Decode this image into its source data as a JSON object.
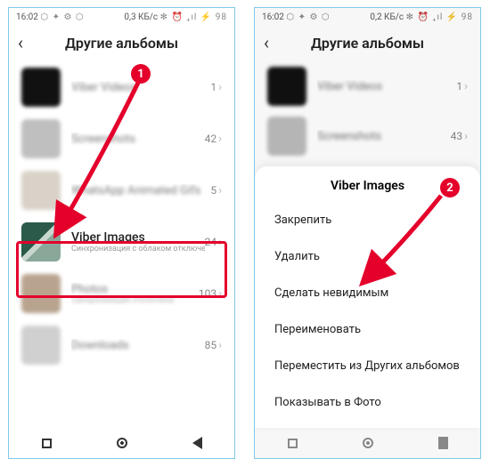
{
  "status": {
    "time": "16:02",
    "icons_left": "⬡ ✦ ⚙ ⬡",
    "net_left": "0,3 КБ/с",
    "net_right": "0,2 КБ/с",
    "icons_right": "✻ ⏰ ₊ıl ⚡ 98"
  },
  "header": {
    "title": "Другие альбомы"
  },
  "albums": [
    {
      "name": "Viber Videos",
      "sub": "",
      "count": "1"
    },
    {
      "name": "Screenshots",
      "sub": "",
      "count": "42"
    },
    {
      "name": "WhatsApp Animated Gifs",
      "sub": "",
      "count": "5"
    },
    {
      "name": "Viber Images",
      "sub": "Синхронизация с облаком отключена",
      "count": "24"
    },
    {
      "name": "Photos",
      "sub": "Синхронизация отключена",
      "count": "103"
    },
    {
      "name": "Downloads",
      "sub": "",
      "count": "85"
    }
  ],
  "albums_right": [
    {
      "name": "Viber Videos",
      "count": "1"
    },
    {
      "name": "Screenshots",
      "count": "43"
    }
  ],
  "sheet": {
    "title": "Viber Images",
    "items": [
      "Закрепить",
      "Удалить",
      "Сделать невидимым",
      "Переименовать",
      "Переместить из Других альбомов",
      "Показывать в Фото"
    ]
  },
  "callouts": {
    "one": "1",
    "two": "2"
  }
}
